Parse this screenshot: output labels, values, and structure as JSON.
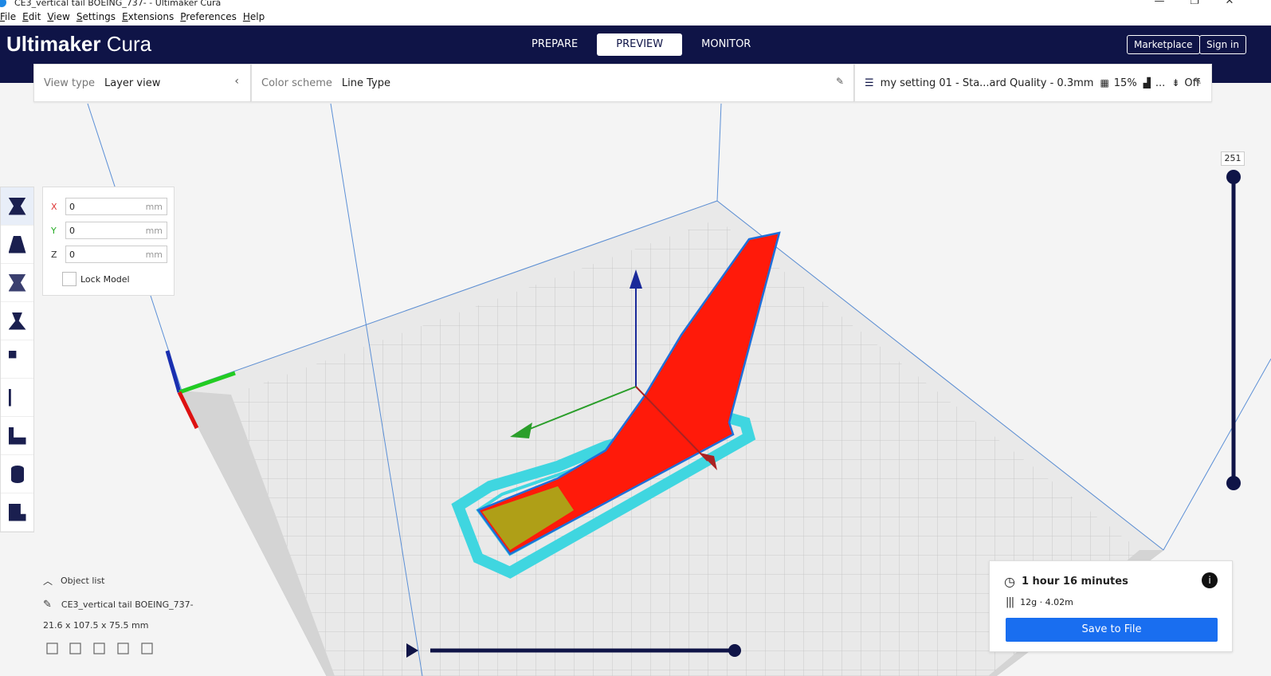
{
  "window": {
    "title": "CE3_vertical tail BOEING_737- - Ultimaker Cura"
  },
  "menu": [
    "File",
    "Edit",
    "View",
    "Settings",
    "Extensions",
    "Preferences",
    "Help"
  ],
  "header": {
    "logo_bold": "Ultimaker",
    "logo_light": "Cura",
    "tabs": [
      "PREPARE",
      "PREVIEW",
      "MONITOR"
    ],
    "active_tab": "PREVIEW",
    "marketplace": "Marketplace",
    "sign_in": "Sign in"
  },
  "view_type": {
    "label": "View type",
    "value": "Layer view"
  },
  "color_scheme": {
    "label": "Color scheme",
    "value": "Line Type"
  },
  "print_setup": {
    "profile": "my setting 01 - Sta...ard Quality - 0.3mm",
    "infill": "15%",
    "support": "...",
    "adhesion": "Off"
  },
  "move_tool": {
    "x_label": "X",
    "x_value": "0",
    "y_label": "Y",
    "y_value": "0",
    "z_label": "Z",
    "z_value": "0",
    "unit": "mm",
    "lock_label": "Lock Model"
  },
  "object_list": {
    "title": "Object list",
    "object_name": "CE3_vertical tail BOEING_737-",
    "dimensions": "21.6 x 107.5 x 75.5 mm"
  },
  "layer": {
    "current": "251"
  },
  "print_info": {
    "time": "1 hour 16 minutes",
    "material": "12g · 4.02m",
    "save_label": "Save to File"
  },
  "colors": {
    "header_bg": "#0f1447",
    "accent_blue": "#196ef0",
    "model_red": "#ff1a0a",
    "skirt_cyan": "#3fd6e0"
  }
}
